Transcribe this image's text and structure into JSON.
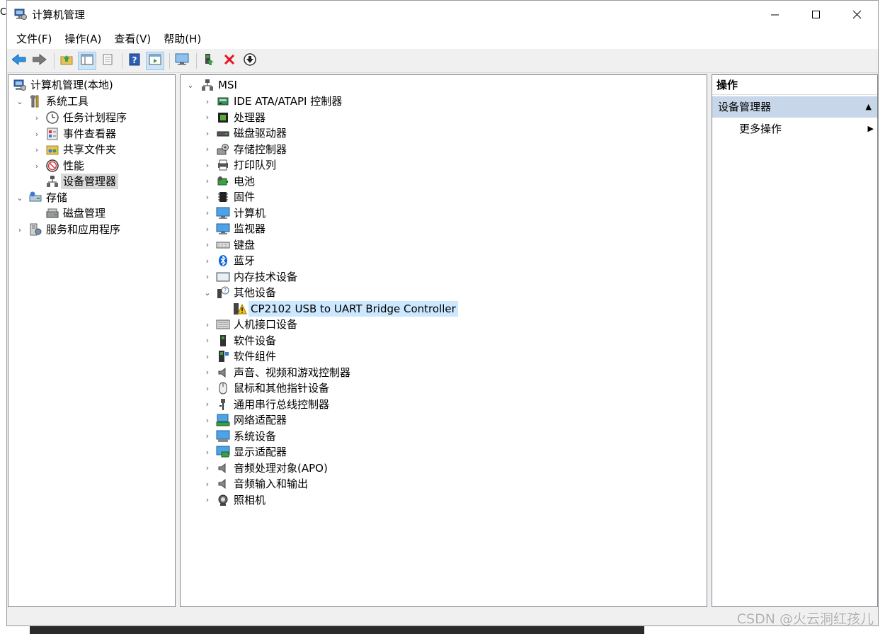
{
  "window": {
    "title": "计算机管理"
  },
  "edge_text": "C",
  "menubar": {
    "items": [
      "文件(F)",
      "操作(A)",
      "查看(V)",
      "帮助(H)"
    ]
  },
  "left_tree": {
    "root": "计算机管理(本地)",
    "system_tools": "系统工具",
    "task_scheduler": "任务计划程序",
    "event_viewer": "事件查看器",
    "shared_folders": "共享文件夹",
    "performance": "性能",
    "device_manager": "设备管理器",
    "storage": "存储",
    "disk_management": "磁盘管理",
    "services_apps": "服务和应用程序"
  },
  "device_tree": {
    "root": "MSI",
    "categories": [
      "IDE ATA/ATAPI 控制器",
      "处理器",
      "磁盘驱动器",
      "存储控制器",
      "打印队列",
      "电池",
      "固件",
      "计算机",
      "监视器",
      "键盘",
      "蓝牙",
      "内存技术设备",
      "其他设备",
      "人机接口设备",
      "软件设备",
      "软件组件",
      "声音、视频和游戏控制器",
      "鼠标和其他指针设备",
      "通用串行总线控制器",
      "网络适配器",
      "系统设备",
      "显示适配器",
      "音频处理对象(APO)",
      "音频输入和输出",
      "照相机"
    ],
    "other_device_child": "CP2102 USB to UART Bridge Controller"
  },
  "actions": {
    "header": "操作",
    "group": "设备管理器",
    "more": "更多操作"
  },
  "watermark": "CSDN @火云洞红孩儿",
  "colors": {
    "selection": "#cce8ff",
    "action_group": "#c7d7e9",
    "warning": "#f5c518",
    "close_red": "#e81123",
    "help_blue": "#2b5fb4",
    "bluetooth_blue": "#0a64d8"
  }
}
